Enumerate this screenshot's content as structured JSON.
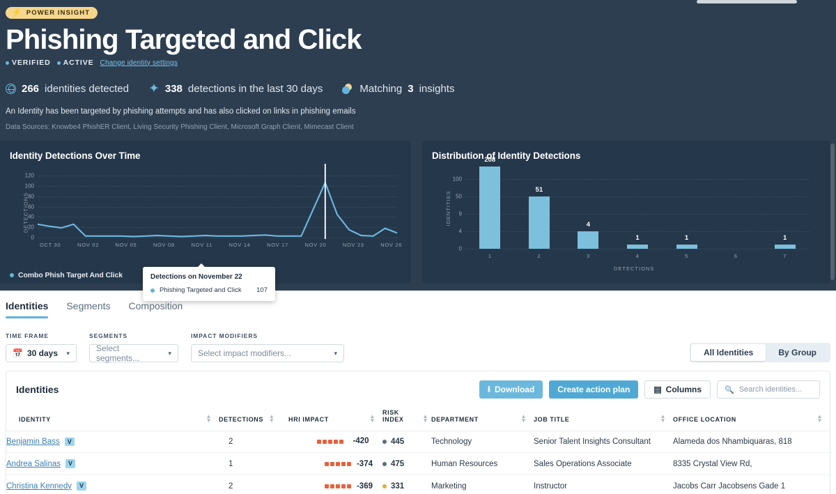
{
  "header": {
    "badge": "POWER INSIGHT",
    "badge_icon": "bolt-icon",
    "title": "Phishing Targeted and Click",
    "status_verified": "VERIFIED",
    "status_active": "ACTIVE",
    "settings_link": "Change identity settings",
    "stats": [
      {
        "icon": "globe-icon",
        "value": "266",
        "text": " identities detected"
      },
      {
        "icon": "sparkle-icon",
        "value": "338",
        "text": " detections in the last 30 days"
      }
    ],
    "insights": {
      "icon": "insights-circles-icon",
      "prefix": "Matching ",
      "value": "3",
      "suffix": " insights"
    },
    "description": "An Identity has been targeted by phishing attempts and has also clicked on links in phishing emails",
    "data_sources": "Data Sources: Knowbe4 PhishER Client, Living Security Phishing Client, Microsoft Graph Client, Mimecast Client"
  },
  "chart_data": [
    {
      "type": "line",
      "title": "Identity Detections Over Time",
      "xlabel": "",
      "ylabel": "DETECTIONS",
      "ylim": [
        0,
        130
      ],
      "yticks": [
        0,
        20,
        40,
        60,
        80,
        100,
        120
      ],
      "grid": true,
      "legend": [
        "Combo Phish Target And Click"
      ],
      "legend_position": "bottom-left",
      "series_color": "#6cb8e0",
      "xtick_labels": [
        "OCT 30",
        "NOV 02",
        "NOV 05",
        "NOV 08",
        "NOV 11",
        "NOV 14",
        "NOV 17",
        "NOV 20",
        "NOV 23",
        "NOV 26"
      ],
      "x": [
        "OCT 29",
        "OCT 30",
        "OCT 31",
        "NOV 01",
        "NOV 02",
        "NOV 03",
        "NOV 04",
        "NOV 05",
        "NOV 06",
        "NOV 07",
        "NOV 08",
        "NOV 09",
        "NOV 10",
        "NOV 11",
        "NOV 12",
        "NOV 13",
        "NOV 14",
        "NOV 15",
        "NOV 16",
        "NOV 17",
        "NOV 18",
        "NOV 19",
        "NOV 20",
        "NOV 21",
        "NOV 22",
        "NOV 23",
        "NOV 24",
        "NOV 25",
        "NOV 26",
        "NOV 27",
        "NOV 28"
      ],
      "values": [
        26,
        22,
        19,
        26,
        3,
        3,
        3,
        3,
        2,
        3,
        4,
        3,
        2,
        3,
        4,
        3,
        3,
        3,
        4,
        5,
        3,
        3,
        3,
        55,
        107,
        45,
        15,
        4,
        3,
        18,
        9
      ],
      "highlight_index": 24,
      "highlight_label": "NOV 22"
    },
    {
      "type": "bar",
      "title": "Distribution of Identity Detections",
      "xlabel": "DETECTIONS",
      "ylabel": "IDENTITIES",
      "yticks": [
        0,
        4,
        9,
        50,
        100
      ],
      "grid": true,
      "bar_color": "#7cc0dd",
      "categories": [
        "1",
        "2",
        "3",
        "4",
        "5",
        "6",
        "7"
      ],
      "values": [
        208,
        51,
        4,
        1,
        1,
        0,
        1
      ]
    }
  ],
  "tooltip": {
    "title": "Detections on November 22",
    "series_name": "Phishing Targeted and Click",
    "series_value": "107"
  },
  "tabs": [
    {
      "label": "Identities",
      "active": true
    },
    {
      "label": "Segments",
      "active": false
    },
    {
      "label": "Composition",
      "active": false
    }
  ],
  "filters": {
    "time_frame": {
      "label": "TIME FRAME",
      "value": "30 days",
      "icon": "calendar-icon"
    },
    "segments": {
      "label": "SEGMENTS",
      "placeholder": "Select segments..."
    },
    "impact_modifiers": {
      "label": "IMPACT MODIFIERS",
      "placeholder": "Select impact modifiers..."
    },
    "view_toggle": {
      "all": "All Identities",
      "group": "By Group",
      "active": "All Identities"
    }
  },
  "table": {
    "title": "Identities",
    "download_button": "Download",
    "download_icon": "download-icon",
    "action_plan_button": "Create action plan",
    "columns_button": "Columns",
    "columns_icon": "columns-icon",
    "search_placeholder": "Search identities...",
    "search_icon": "search-icon",
    "headers": [
      {
        "label": "IDENTITY",
        "sortable": true
      },
      {
        "label": "DETECTIONS",
        "sortable": true
      },
      {
        "label": "HRI IMPACT",
        "sortable": true
      },
      {
        "label": "RISK INDEX",
        "sortable": true
      },
      {
        "label": "DEPARTMENT",
        "sortable": true
      },
      {
        "label": "JOB TITLE",
        "sortable": true
      },
      {
        "label": "OFFICE LOCATION",
        "sortable": true
      }
    ],
    "rows": [
      {
        "identity": "Benjamin Bass",
        "verified_badge": "V",
        "detections": "2",
        "hri_dots": 5,
        "hri_value": "-420",
        "hri_wrap": true,
        "risk_index": "445",
        "risk_color": "#5a6e81",
        "department": "Technology",
        "job_title": "Senior Talent Insights Consultant",
        "office_location": "Alameda dos Nhambiquaras, 818"
      },
      {
        "identity": "Andrea Salinas",
        "verified_badge": "V",
        "detections": "1",
        "hri_dots": 5,
        "hri_value": "-374",
        "hri_wrap": false,
        "risk_index": "475",
        "risk_color": "#5a6e81",
        "department": "Human Resources",
        "job_title": "Sales Operations Associate",
        "office_location": "8335 Crystal View Rd,"
      },
      {
        "identity": "Christina Kennedy",
        "verified_badge": "V",
        "detections": "2",
        "hri_dots": 5,
        "hri_value": "-369",
        "hri_wrap": false,
        "risk_index": "331",
        "risk_color": "#e0a93c",
        "department": "Marketing",
        "job_title": "Instructor",
        "office_location": "Jacobs Carr Jacobsens Gade 1"
      }
    ]
  },
  "colors": {
    "hero_bg": "#2d3e50",
    "panel_bg": "#25374a",
    "accent_blue": "#6cb8e0",
    "badge_yellow": "#f6d68b",
    "hri_orange": "#e8613c"
  }
}
